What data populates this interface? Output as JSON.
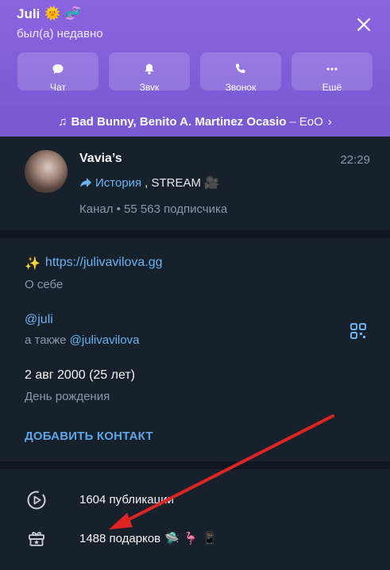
{
  "header": {
    "title": "Juli",
    "emoji_1": "🌞",
    "emoji_2": "🧬",
    "status": "был(а) недавно",
    "actions": [
      {
        "label": "Чат",
        "icon": "chat-icon"
      },
      {
        "label": "Звук",
        "icon": "bell-icon"
      },
      {
        "label": "Звонок",
        "icon": "phone-icon"
      },
      {
        "label": "Ещё",
        "icon": "more-icon"
      }
    ]
  },
  "music": {
    "note": "♫",
    "song": "Bad Bunny, Benito A. Martinez Ocasio",
    "dash": "–",
    "track": "EoO",
    "chevron": "›"
  },
  "channel": {
    "name": "Vavia’s",
    "time": "22:29",
    "last_story": "История",
    "last_rest": ", STREAM",
    "last_emoji": "🎥",
    "subtitle": "Канал • 55 563 подписчика"
  },
  "info": {
    "link_emoji": "✨",
    "link": "https://julivavilova.gg",
    "link_label": "О себе",
    "username": "@juli",
    "also_prefix": "а также",
    "also_username": "@julivavilova",
    "birthday": "2 авг 2000 (25 лет)",
    "birthday_label": "День рождения",
    "add_contact": "ДОБАВИТЬ КОНТАКТ"
  },
  "stats": {
    "posts": "1604 публикации",
    "gifts": "1488 подарков",
    "gift_emojis": [
      "🛸",
      "🦩",
      "📱"
    ]
  },
  "colors": {
    "header_bg": "#8a64e0",
    "music_bg": "#7a5ad2",
    "page_bg": "#17212b",
    "accent_link": "#6ab3f3",
    "annotation_arrow": "#e02424"
  }
}
